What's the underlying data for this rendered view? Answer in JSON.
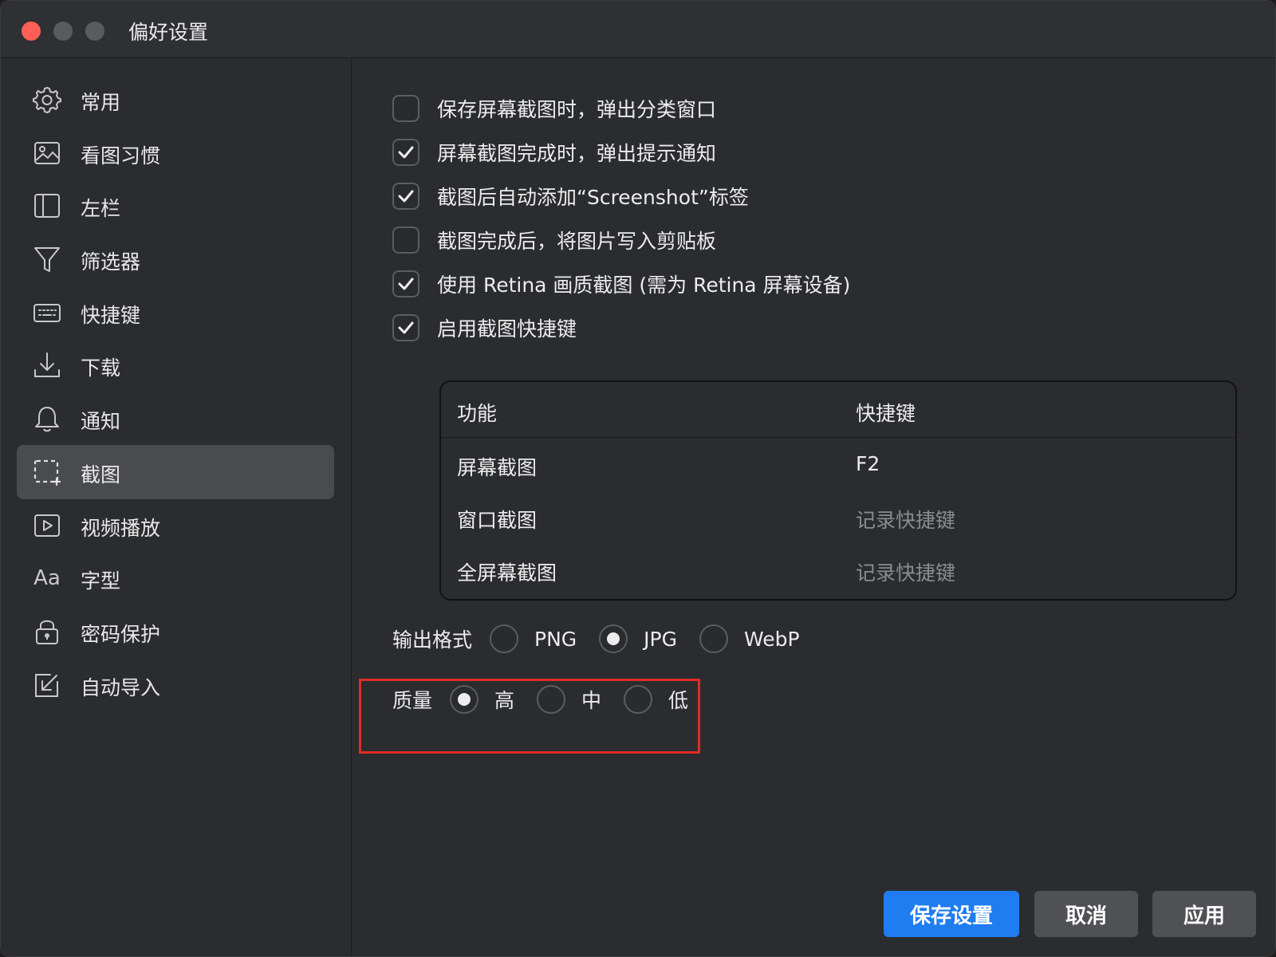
{
  "window": {
    "title": "偏好设置"
  },
  "sidebar": {
    "items": [
      {
        "label": "常用",
        "icon": "gear-icon"
      },
      {
        "label": "看图习惯",
        "icon": "image-icon"
      },
      {
        "label": "左栏",
        "icon": "sidebar-icon"
      },
      {
        "label": "筛选器",
        "icon": "filter-icon"
      },
      {
        "label": "快捷键",
        "icon": "keyboard-icon"
      },
      {
        "label": "下载",
        "icon": "download-icon"
      },
      {
        "label": "通知",
        "icon": "bell-icon"
      },
      {
        "label": "截图",
        "icon": "screenshot-icon",
        "active": true
      },
      {
        "label": "视频播放",
        "icon": "play-icon"
      },
      {
        "label": "字型",
        "icon": "font-icon",
        "icon_text": "Aa"
      },
      {
        "label": "密码保护",
        "icon": "lock-icon"
      },
      {
        "label": "自动导入",
        "icon": "import-icon"
      }
    ]
  },
  "options": [
    {
      "label": "保存屏幕截图时，弹出分类窗口",
      "checked": false
    },
    {
      "label": "屏幕截图完成时，弹出提示通知",
      "checked": true
    },
    {
      "label": "截图后自动添加“Screenshot”标签",
      "checked": true
    },
    {
      "label": "截图完成后，将图片写入剪贴板",
      "checked": false
    },
    {
      "label": "使用 Retina 画质截图 (需为 Retina 屏幕设备)",
      "checked": true
    },
    {
      "label": "启用截图快捷键",
      "checked": true
    }
  ],
  "shortcuts": {
    "headers": {
      "function": "功能",
      "key": "快捷键"
    },
    "rows": [
      {
        "function": "屏幕截图",
        "key": "F2"
      },
      {
        "function": "窗口截图",
        "key": "记录快捷键"
      },
      {
        "function": "全屏幕截图",
        "key": "记录快捷键"
      }
    ]
  },
  "output_format": {
    "label": "输出格式",
    "options": [
      "PNG",
      "JPG",
      "WebP"
    ],
    "selected": "JPG"
  },
  "quality": {
    "label": "质量",
    "options": [
      "高",
      "中",
      "低"
    ],
    "selected": "高"
  },
  "buttons": {
    "save": "保存设置",
    "cancel": "取消",
    "apply": "应用"
  },
  "colors": {
    "accent": "#1f7cf1",
    "highlight": "#e02c24",
    "close": "#ff5f57"
  }
}
